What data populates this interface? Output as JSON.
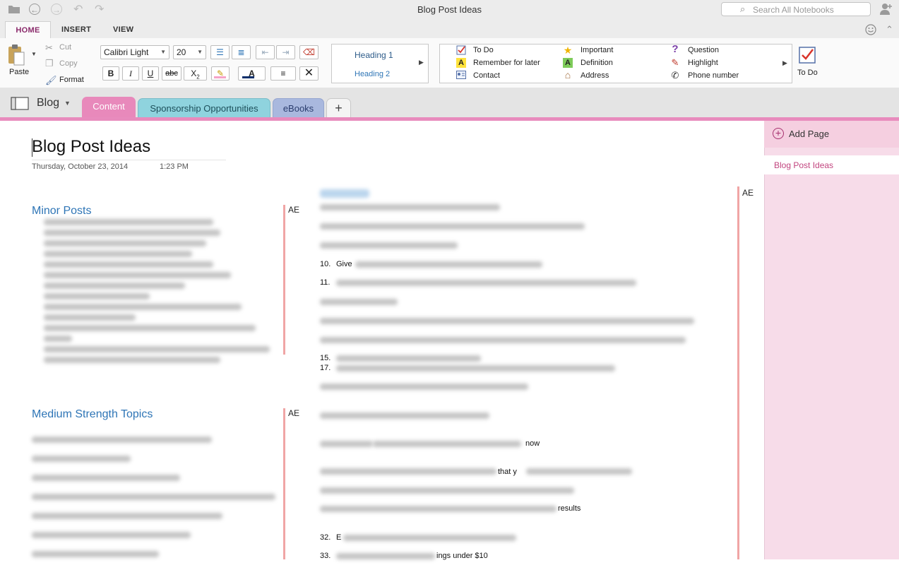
{
  "window": {
    "title": "Blog Post Ideas",
    "search_placeholder": "Search All Notebooks"
  },
  "icons": {
    "folder": "folder-icon",
    "back": "back-arrow-icon",
    "forward": "forward-arrow-icon",
    "undo": "undo-icon",
    "redo": "redo-icon",
    "share": "add-person-icon",
    "smiley": "smiley-icon",
    "collapse": "chevron-up-icon"
  },
  "ribbon_tabs": [
    "HOME",
    "INSERT",
    "VIEW"
  ],
  "clipboard": {
    "paste": "Paste",
    "cut": "Cut",
    "copy": "Copy",
    "format": "Format"
  },
  "font": {
    "family": "Calibri Light",
    "size": "20"
  },
  "styles": {
    "heading1": "Heading 1",
    "heading2": "Heading 2"
  },
  "tags": [
    {
      "label": "To Do",
      "icon": "checkbox-icon"
    },
    {
      "label": "Remember for later",
      "icon": "highlight-a-icon"
    },
    {
      "label": "Contact",
      "icon": "contact-card-icon"
    },
    {
      "label": "Important",
      "icon": "star-icon"
    },
    {
      "label": "Definition",
      "icon": "definition-a-icon"
    },
    {
      "label": "Address",
      "icon": "house-icon"
    },
    {
      "label": "Question",
      "icon": "question-icon"
    },
    {
      "label": "Highlight",
      "icon": "highlighter-icon"
    },
    {
      "label": "Phone number",
      "icon": "phone-icon"
    }
  ],
  "todo_button": "To Do",
  "notebook": {
    "name": "Blog"
  },
  "sections": [
    {
      "label": "Content",
      "color": "#e889bb"
    },
    {
      "label": "Sponsorship Opportunities",
      "color": "#8fd3de"
    },
    {
      "label": "eBooks",
      "color": "#a9b8de"
    }
  ],
  "add_section": "+",
  "page": {
    "title": "Blog Post Ideas",
    "date": "Thursday, October 23, 2014",
    "time": "1:23 PM",
    "author": "AE",
    "minor_heading": "Minor Posts",
    "medium_heading": "Medium Strength Topics",
    "numbers": {
      "n10": "10.",
      "n11": "11.",
      "n15": "15.",
      "n17": "17.",
      "n32": "32.",
      "n33": "33."
    },
    "fragments": {
      "give": "Give",
      "now": "now",
      "that": "that y",
      "results": "results",
      "e": "E",
      "under": "ings under $10"
    }
  },
  "sidebar": {
    "add_page": "Add Page",
    "pages": [
      "Blog Post Ideas"
    ]
  },
  "colors": {
    "accent": "#8a2a6b",
    "section_line": "#e88bbd",
    "heading_blue": "#2e75b6",
    "page_pane": "#f7dce9"
  }
}
